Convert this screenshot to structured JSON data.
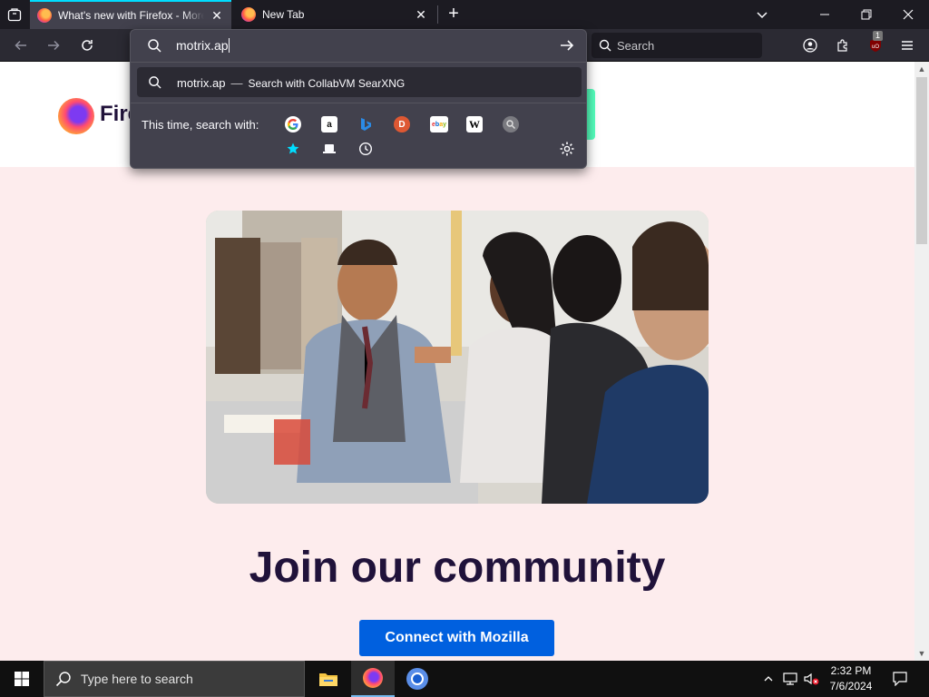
{
  "tabs": [
    {
      "title": "What's new with Firefox - More ...",
      "active": true
    },
    {
      "title": "New Tab",
      "active": false
    }
  ],
  "urlbar": {
    "typed": "motrix.ap",
    "result_text": "motrix.ap",
    "result_separator": "—",
    "result_action": "Search with CollabVM SearXNG",
    "oneoff_label": "This time, search with:",
    "engines": [
      "google-icon",
      "amazon-icon",
      "bing-icon",
      "duckduckgo-icon",
      "ebay-icon",
      "wikipedia-icon",
      "searxng-icon",
      "bookmarks-icon",
      "tabs-icon",
      "history-icon"
    ]
  },
  "searchbar": {
    "placeholder": "Search"
  },
  "extension_badge": "1",
  "page": {
    "logo_text": "Firef",
    "heading": "Join our community",
    "cta": "Connect with Mozilla"
  },
  "taskbar": {
    "search_placeholder": "Type here to search",
    "time": "2:32 PM",
    "date": "7/6/2024"
  },
  "colors": {
    "accent": "#00ddff",
    "page_bg": "#fdeced",
    "heading": "#20123a",
    "cta_bg": "#0060df"
  }
}
